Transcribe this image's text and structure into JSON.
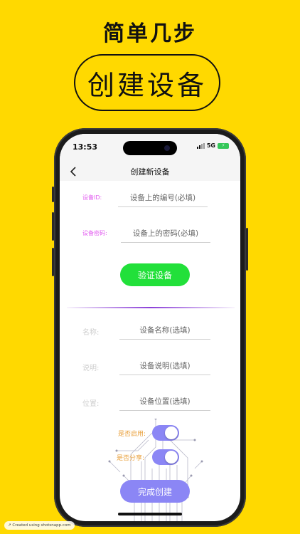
{
  "promo": {
    "headline": "简单几步",
    "pill_text": "创建设备"
  },
  "status": {
    "time": "13:53",
    "network": "5G",
    "battery_charging_glyph": "⚡"
  },
  "nav": {
    "back_glyph": "<",
    "title": "创建新设备"
  },
  "form": {
    "device_id": {
      "label": "设备ID:",
      "placeholder": "设备上的编号(必填)"
    },
    "device_password": {
      "label": "设备密码:",
      "placeholder": "设备上的密码(必填)"
    },
    "verify_button": "验证设备",
    "name": {
      "label": "名称:",
      "placeholder": "设备名称(选填)"
    },
    "description": {
      "label": "说明:",
      "placeholder": "设备说明(选填)"
    },
    "location": {
      "label": "位置:",
      "placeholder": "设备位置(选填)"
    },
    "enabled": {
      "label": "是否启用:",
      "on": true
    },
    "shared": {
      "label": "是否分享:",
      "on": true
    },
    "finish_button": "完成创建"
  },
  "watermark": "Created using shotsnapp.com",
  "colors": {
    "background": "#FFD900",
    "verify_button": "#22E03A",
    "accent_purple": "#8B86F5",
    "label_pink": "#E25CF0",
    "label_orange": "#E9A03C"
  }
}
